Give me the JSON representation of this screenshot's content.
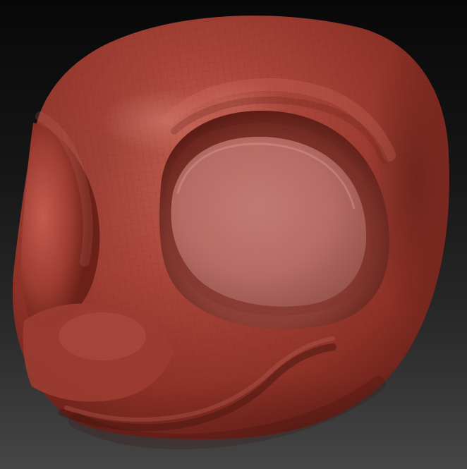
{
  "scene": {
    "subject_icon": "sculpted-creature-head-icon",
    "colors": {
      "background_top": "#080808",
      "background_bottom": "#464646",
      "clay_base": "#9a3b2e",
      "clay_highlight": "#d77a67",
      "clay_shadow": "#4a1611",
      "wire": "#6d241c"
    }
  }
}
